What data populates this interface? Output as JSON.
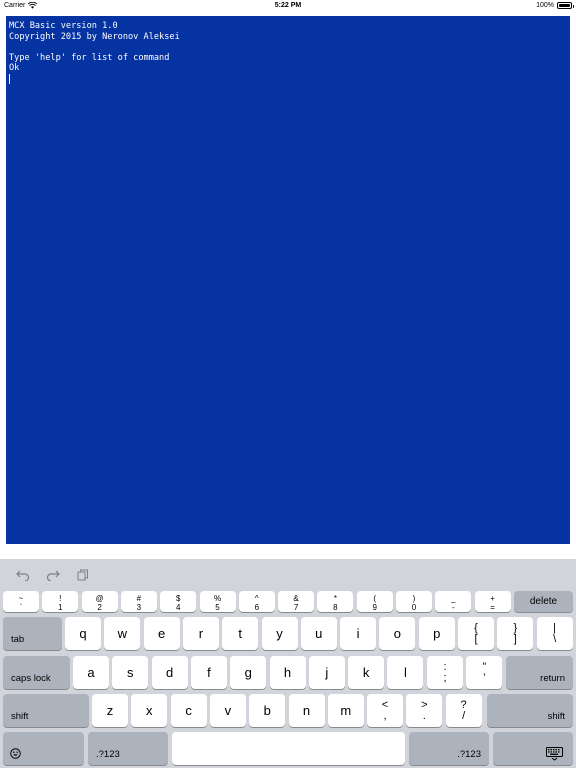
{
  "status_bar": {
    "carrier": "Carrier",
    "time": "5:22 PM",
    "battery": "100%",
    "battery_level": 1.0,
    "wifi_icon": "wifi-icon",
    "battery_icon": "battery-icon"
  },
  "terminal": {
    "background": "#0533a1",
    "lines": [
      "MCX Basic version 1.0",
      "Copyright 2015 by Neronov Aleksei",
      "",
      "Type 'help' for list of command",
      "Ok"
    ]
  },
  "keyboard": {
    "toolbar": {
      "undo_icon": "undo-icon",
      "redo_icon": "redo-icon",
      "paste_icon": "paste-icon"
    },
    "num_row": [
      {
        "top": "~",
        "bottom": "`"
      },
      {
        "top": "!",
        "bottom": "1"
      },
      {
        "top": "@",
        "bottom": "2"
      },
      {
        "top": "#",
        "bottom": "3"
      },
      {
        "top": "$",
        "bottom": "4"
      },
      {
        "top": "%",
        "bottom": "5"
      },
      {
        "top": "^",
        "bottom": "6"
      },
      {
        "top": "&",
        "bottom": "7"
      },
      {
        "top": "*",
        "bottom": "8"
      },
      {
        "top": "(",
        "bottom": "9"
      },
      {
        "top": ")",
        "bottom": "0"
      },
      {
        "top": "_",
        "bottom": "-"
      },
      {
        "top": "+",
        "bottom": "="
      }
    ],
    "delete": "delete",
    "tab": "tab",
    "row_q": [
      "q",
      "w",
      "e",
      "r",
      "t",
      "y",
      "u",
      "i",
      "o",
      "p"
    ],
    "row_q_sym": [
      {
        "top": "{",
        "bottom": "["
      },
      {
        "top": "}",
        "bottom": "]"
      },
      {
        "top": "|",
        "bottom": "\\"
      }
    ],
    "caps_lock": "caps lock",
    "row_a": [
      "a",
      "s",
      "d",
      "f",
      "g",
      "h",
      "j",
      "k",
      "l"
    ],
    "row_a_sym": [
      {
        "top": ":",
        "bottom": ";"
      },
      {
        "top": "”",
        "bottom": "’"
      }
    ],
    "return": "return",
    "shift": "shift",
    "row_z": [
      "z",
      "x",
      "c",
      "v",
      "b",
      "n",
      "m"
    ],
    "row_z_sym": [
      {
        "top": "<",
        "bottom": ","
      },
      {
        "top": ">",
        "bottom": "."
      },
      {
        "top": "?",
        "bottom": "/"
      }
    ],
    "numbers": ".?123",
    "emoji_icon": "emoji-icon",
    "hide_keyboard_icon": "keyboard-dismiss-icon"
  }
}
